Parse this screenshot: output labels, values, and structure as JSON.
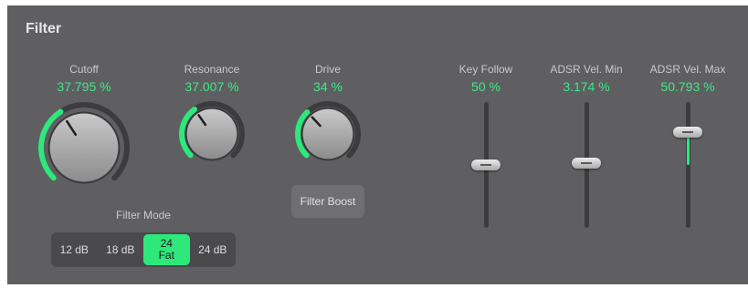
{
  "title": "Filter",
  "knobs": [
    {
      "label": "Cutoff",
      "value": "37.795 %",
      "fraction": 0.378
    },
    {
      "label": "Resonance",
      "value": "37.007 %",
      "fraction": 0.37
    },
    {
      "label": "Drive",
      "value": "34 %",
      "fraction": 0.34
    }
  ],
  "filter_mode": {
    "label": "Filter Mode",
    "options": [
      "12 dB",
      "18 dB",
      "24\nFat",
      "24 dB"
    ],
    "selected": "24\nFat"
  },
  "filter_boost": "Filter Boost",
  "sliders": [
    {
      "label": "Key Follow",
      "value": "50 %",
      "fraction": 0.5,
      "bipolar": true
    },
    {
      "label": "ADSR Vel. Min",
      "value": "3.174 %",
      "fraction": 0.516,
      "bipolar": true
    },
    {
      "label": "ADSR Vel. Max",
      "value": "50.793 %",
      "fraction": 0.762,
      "bipolar": true
    }
  ],
  "colors": {
    "accent": "#2ee87c",
    "panel": "#5f5f62",
    "value_text": "#3ce88a"
  }
}
